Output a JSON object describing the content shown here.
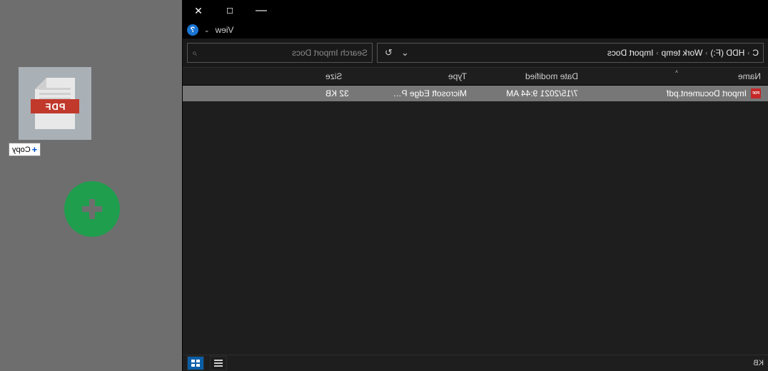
{
  "titlebar": {
    "min": "—",
    "max": "☐",
    "close": "✕"
  },
  "menubar": {
    "help": "?",
    "view": "View"
  },
  "breadcrumb": {
    "c": "C",
    "hdd": "HDD (F:)",
    "work": "Work temp",
    "import": "Import Docs"
  },
  "addr_tools": {
    "dropdown": "⌄",
    "refresh": "↻"
  },
  "search": {
    "placeholder": "Search Import Docs",
    "icon": "⌕"
  },
  "columns": {
    "name": "Name",
    "date": "Date modified",
    "type": "Type",
    "size": "Size",
    "sort": "˄"
  },
  "files": [
    {
      "name": "Import Document.pdf",
      "date": "7/15/2021 9:44 AM",
      "type": "Microsoft Edge P…",
      "size": "32 KB",
      "icon": "PDF"
    }
  ],
  "statusbar": {
    "kb": "KB"
  },
  "drag": {
    "band": "PDF",
    "label": "Copy",
    "plus": "+"
  },
  "green_plus": {}
}
